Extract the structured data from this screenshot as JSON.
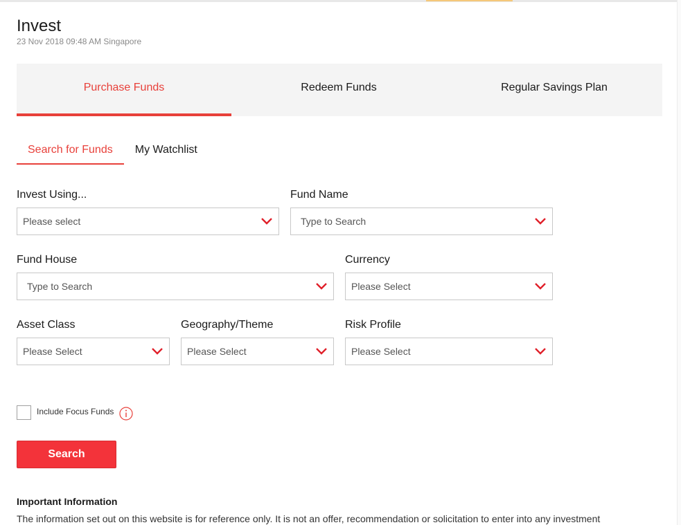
{
  "page": {
    "title": "Invest",
    "timestamp": "23 Nov 2018 09:48 AM Singapore"
  },
  "main_tabs": [
    {
      "label": "Purchase Funds",
      "active": true
    },
    {
      "label": "Redeem Funds",
      "active": false
    },
    {
      "label": "Regular Savings Plan",
      "active": false
    }
  ],
  "sub_tabs": [
    {
      "label": "Search for Funds",
      "active": true
    },
    {
      "label": "My Watchlist",
      "active": false
    }
  ],
  "filters": {
    "invest_using": {
      "label": "Invest Using...",
      "value": "Please select"
    },
    "fund_name": {
      "label": "Fund Name",
      "value": "Type to Search"
    },
    "fund_house": {
      "label": "Fund House",
      "value": "Type to Search"
    },
    "currency": {
      "label": "Currency",
      "value": "Please Select"
    },
    "asset_class": {
      "label": "Asset Class",
      "value": "Please Select"
    },
    "geography_theme": {
      "label": "Geography/Theme",
      "value": "Please Select"
    },
    "risk_profile": {
      "label": "Risk Profile",
      "value": "Please Select"
    }
  },
  "focus_funds": {
    "label": "Include Focus Funds",
    "checked": false
  },
  "search_button": {
    "label": "Search"
  },
  "important_info": {
    "heading": "Important Information",
    "text": "The information set out on this website is for reference only. It is not an offer, recommendation or solicitation to enter into any investment"
  },
  "colors": {
    "accent": "#e8403a",
    "button": "#f3333a",
    "tab_background": "#f4f4f4"
  },
  "icons": {
    "dropdown": "chevron-down-icon",
    "info": "info-icon"
  }
}
